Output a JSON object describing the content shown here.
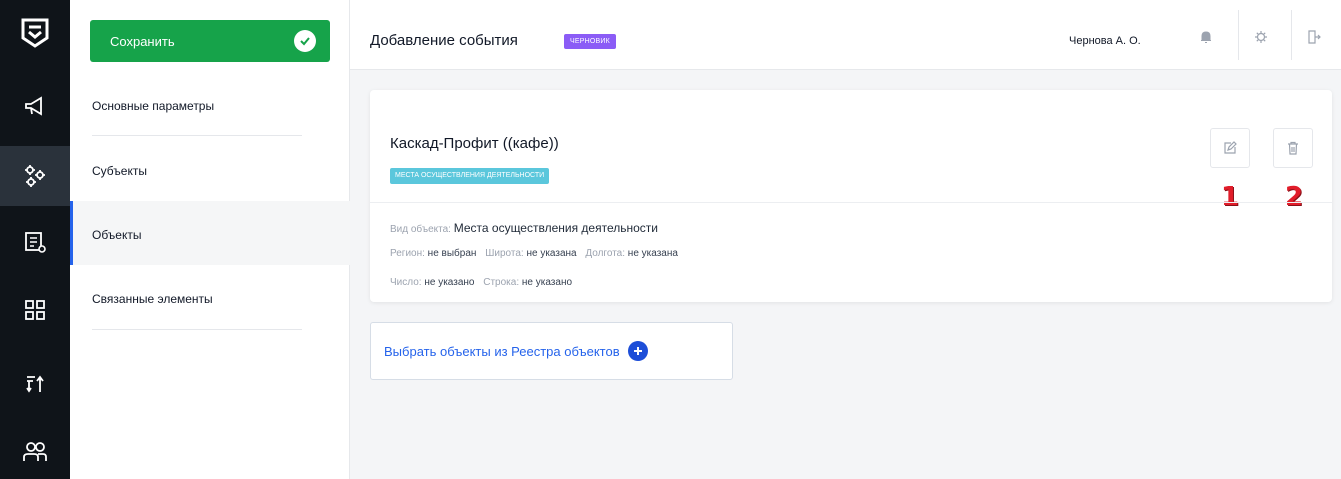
{
  "app": {
    "title": "Добавление события",
    "status_badge": "черновик",
    "user": "Чернова А. О."
  },
  "rail": {
    "items": [
      {
        "icon": "megaphone-icon"
      },
      {
        "icon": "settings-gears-icon"
      },
      {
        "icon": "document-list-icon"
      },
      {
        "icon": "grid-icon"
      },
      {
        "icon": "sort-icon"
      },
      {
        "icon": "users-icon"
      }
    ]
  },
  "left": {
    "save_label": "Сохранить",
    "nav": [
      {
        "label": "Основные параметры"
      },
      {
        "label": "Субъекты"
      },
      {
        "label": "Объекты"
      },
      {
        "label": "Связанные элементы"
      }
    ]
  },
  "object_card": {
    "title": "Каскад-Профит ((кафе))",
    "tag": "места осуществления деятельности",
    "numbers": [
      "1",
      "2"
    ],
    "kind_label": "Вид объекта:",
    "kind_value": "Места осуществления деятельности",
    "region_label": "Регион:",
    "region_value": "не выбран",
    "lat_label": "Широта:",
    "lat_value": "не указана",
    "lon_label": "Долгота:",
    "lon_value": "не указана",
    "number_label": "Число:",
    "number_value": "не указано",
    "string_label": "Строка:",
    "string_value": "не указано"
  },
  "select_objects_label": "Выбрать объекты из Реестра объектов",
  "colors": {
    "rail_bg": "#0f1419",
    "save_green": "#16a34a",
    "draft_purple": "#8b5cf6",
    "tag_cyan": "#5bc7dc",
    "accent_blue": "#2563eb",
    "number_red": "#e11d2a"
  }
}
